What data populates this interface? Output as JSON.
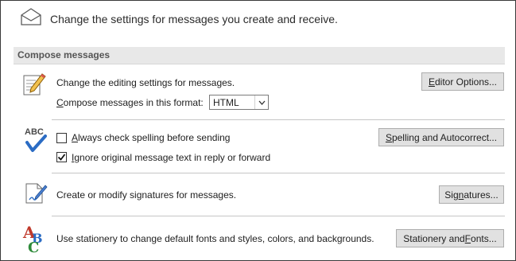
{
  "header": {
    "icon": "envelope-icon",
    "text": "Change the settings for messages you create and receive."
  },
  "section": {
    "title": "Compose messages"
  },
  "editing": {
    "icon": "edit-pencil-icon",
    "description": "Change the editing settings for messages.",
    "format_label_prefix": "C",
    "format_label_rest": "ompose messages in this format:",
    "format_value": "HTML",
    "button_prefix": "",
    "button_mnemonic": "E",
    "button_rest": "ditor Options..."
  },
  "spelling": {
    "icon": "abc-check-icon",
    "icon_text": "ABC",
    "always_check_mnemonic": "A",
    "always_check_rest": "lways check spelling before sending",
    "always_check_checked": false,
    "ignore_mnemonic": "I",
    "ignore_rest": "gnore original message text in reply or forward",
    "ignore_checked": true,
    "button_mnemonic": "S",
    "button_rest": "pelling and Autocorrect..."
  },
  "signatures": {
    "icon": "signature-pen-icon",
    "description": "Create or modify signatures for messages.",
    "button_prefix": "Sig",
    "button_mnemonic": "n",
    "button_rest": "atures..."
  },
  "stationery": {
    "icon": "stationery-abc-icon",
    "description": "Use stationery to change default fonts and styles, colors, and backgrounds.",
    "button_prefix": "Stationery and ",
    "button_mnemonic": "F",
    "button_rest": "onts..."
  },
  "colors": {
    "accent_blue": "#2b6cc4",
    "section_bg": "#e8e8e8",
    "button_bg": "#e1e1e1"
  }
}
